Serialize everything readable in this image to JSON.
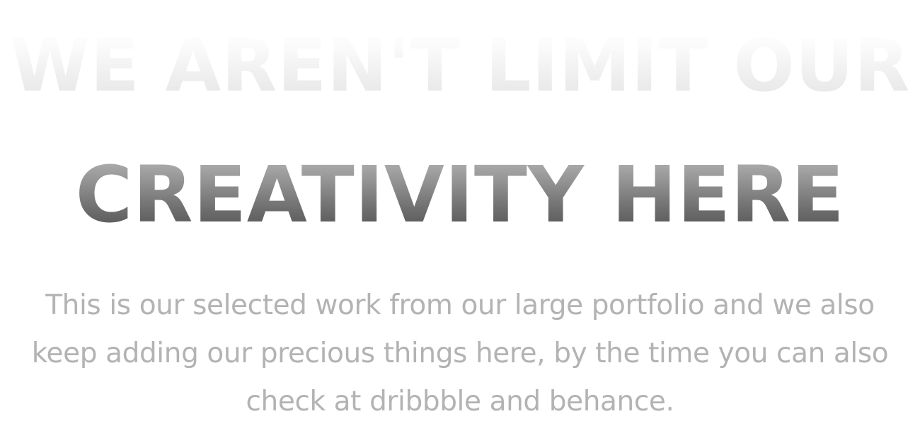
{
  "hero": {
    "headline_line_1": "WE AREN'T LIMIT OUR",
    "headline_line_2": "CREATIVITY HERE",
    "description": "This is our selected work from our large portfolio and we also keep adding our precious things here, by the time you can also check at dribbble and behance."
  },
  "colors": {
    "background": "#ffffff",
    "headline_faded": "#e6e6e6",
    "headline_dark": "#4a4a4a",
    "description_text": "#b3b3b3"
  }
}
